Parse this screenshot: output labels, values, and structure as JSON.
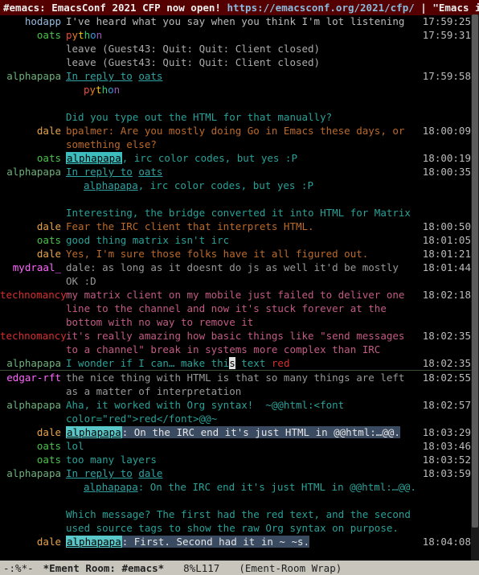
{
  "titlebar": {
    "channel": "#emacs",
    "topic": "EmacsConf 2021 CFP now open!",
    "url": "https://emacsconf.org/2021/cfp/",
    "tail": "|  \"Emacs is a co"
  },
  "messages": [
    {
      "nick": "hodapp",
      "nick_class": "nk-hodapp",
      "body_html": "<span class='body-default'>I've heard what you say when you think I'm lot listening</span>",
      "ts": "17:59:25"
    },
    {
      "nick": "oats",
      "nick_class": "nk-oats",
      "body_html": "<span class='rainbow' data-name='rainbow-text'><span>p</span><span>y</span><span>t</span><span>h</span><span>o</span><span>n</span></span>",
      "ts": "17:59:31"
    },
    {
      "nick": "",
      "nick_class": "",
      "body_html": "<span class='sys-msg'>leave (Guest43: Quit: Quit: Client closed)</span>",
      "ts": ""
    },
    {
      "nick": "",
      "nick_class": "",
      "body_html": "<span class='sys-msg'>leave (Guest43: Quit: Quit: Client closed)</span>",
      "ts": ""
    },
    {
      "nick": "alphapapa",
      "nick_class": "nk-alphapapa",
      "body_html": "<a class='link' data-name='reply-link' data-interactable='true'>In reply to</a> <a class='link' data-name='user-link-oats' data-interactable='true'>oats</a><span class='indent2'><span class='rainbow'><span>p</span><span>y</span><span>t</span><span>h</span><span>o</span><span>n</span></span></span>",
      "ts": "17:59:58"
    },
    {
      "gap": true
    },
    {
      "nick": "",
      "nick_class": "",
      "body_html": "<span class='body-teal'>Did you type out the HTML for that manually?</span>",
      "ts": ""
    },
    {
      "nick": "dale",
      "nick_class": "nk-dale",
      "body_html": "<span class='body-orange'>bpalmer: Are you mostly doing Go in Emacs these days, or something else?</span>",
      "ts": "18:00:09"
    },
    {
      "nick": "oats",
      "nick_class": "nk-oats",
      "body_html": "<span class='mention-box' data-name='mention-alphapapa'>alphapapa</span><span class='body-teal'>, irc color codes, but yes :P</span>",
      "ts": "18:00:19"
    },
    {
      "nick": "alphapapa",
      "nick_class": "nk-alphapapa",
      "body_html": "<a class='link' data-name='reply-link' data-interactable='true'>In reply to</a> <a class='link' data-name='user-link-oats' data-interactable='true'>oats</a><span class='indent2'><a class='link' data-name='user-link-alphapapa' data-interactable='true'>alphapapa</a><span class='body-teal'>, irc color codes, but yes :P</span></span>",
      "ts": "18:00:35"
    },
    {
      "gap": true
    },
    {
      "nick": "",
      "nick_class": "",
      "body_html": "<span class='body-teal'>Interesting, the bridge converted it into HTML for Matrix</span>",
      "ts": ""
    },
    {
      "nick": "dale",
      "nick_class": "nk-dale",
      "body_html": "<span class='body-orange'>Fear the IRC client that interprets HTML.</span>",
      "ts": "18:00:50"
    },
    {
      "nick": "oats",
      "nick_class": "nk-oats",
      "body_html": "<span class='body-teal'>good thing matrix isn't irc</span>",
      "ts": "18:01:05"
    },
    {
      "nick": "dale",
      "nick_class": "nk-dale",
      "body_html": "<span class='body-orange'>Yes, I'm sure those folks have it all figured out.</span>",
      "ts": "18:01:21"
    },
    {
      "nick": "mydraal_",
      "nick_class": "nk-mydraal",
      "body_html": "<span class='body-gray'>dale: as long as it doesnt do js as well it'd be mostly OK :D</span>",
      "ts": "18:01:44"
    },
    {
      "nick": "technomancy",
      "nick_class": "nk-technomancy",
      "body_html": "<span class='body-magentaish'>my matrix client on my mobile just failed to deliver one line to the channel and now it's stuck forever at the bottom with no way to remove it</span>",
      "ts": "18:02:18"
    },
    {
      "nick": "technomancy",
      "nick_class": "nk-technomancy",
      "body_html": "<span class='body-magentaish'>it's really amazing how basic things like \"send messages to a channel\" break in systems more complex than IRC</span>",
      "ts": "18:02:35"
    },
    {
      "nick": "alphapapa",
      "nick_class": "nk-alphapapa",
      "body_html": "<span class='body-teal'>I wonder if I can… make thi</span><span class='cursor' data-name='text-cursor'>s</span><span class='body-teal'> text </span><span class='red-text'>red</span>",
      "ts": "18:02:35",
      "current": true
    },
    {
      "rule": true
    },
    {
      "nick": "edgar-rft",
      "nick_class": "nk-edgar-rft",
      "body_html": "<span class='body-gray'>the nice thing with HTML is that so many things are left as a matter of interpretation</span>",
      "ts": "18:02:55"
    },
    {
      "nick": "alphapapa",
      "nick_class": "nk-alphapapa",
      "body_html": "<span class='body-teal'>Aha, it worked with Org syntax!  ~@@html:&lt;font color=\"red\"&gt;red&lt;/font&gt;@@~</span>",
      "ts": "18:02:57"
    },
    {
      "nick": "dale",
      "nick_class": "nk-dale",
      "body_html": "<span class='hl-line'><span class='mention-box' data-name='mention-alphapapa'>alphapapa</span>: On the IRC end it's just HTML in @@html:…@@.</span>",
      "ts": "18:03:29"
    },
    {
      "nick": "oats",
      "nick_class": "nk-oats",
      "body_html": "<span class='body-teal'>lol</span>",
      "ts": "18:03:46"
    },
    {
      "nick": "oats",
      "nick_class": "nk-oats",
      "body_html": "<span class='body-teal'>too many layers</span>",
      "ts": "18:03:52"
    },
    {
      "nick": "alphapapa",
      "nick_class": "nk-alphapapa",
      "body_html": "<a class='link' data-name='reply-link' data-interactable='true'>In reply to</a> <a class='link' data-name='user-link-dale' data-interactable='true'>dale</a><span class='indent2'><a class='link' data-name='user-link-alphapapa' data-interactable='true'>alphapapa</a><span class='body-teal'>: On the IRC end it's just HTML in @@html:…@@.</span></span>",
      "ts": "18:03:59"
    },
    {
      "gap": true
    },
    {
      "nick": "",
      "nick_class": "",
      "body_html": "<span class='body-teal'>Which message? The first had the red text, and the second used source tags to show the raw Org syntax on purpose.</span>",
      "ts": ""
    },
    {
      "nick": "dale",
      "nick_class": "nk-dale",
      "body_html": "<span class='hl-line'><span class='mention-box' data-name='mention-alphapapa'>alphapapa</span>: First. Second had it in ~ ~s.</span>",
      "ts": "18:04:08"
    }
  ],
  "modeline": {
    "left": "-:%*-",
    "buffer": "*Ement Room: #emacs*",
    "pct": "8%",
    "line": "L117",
    "mode": "(Ement-Room Wrap)"
  }
}
